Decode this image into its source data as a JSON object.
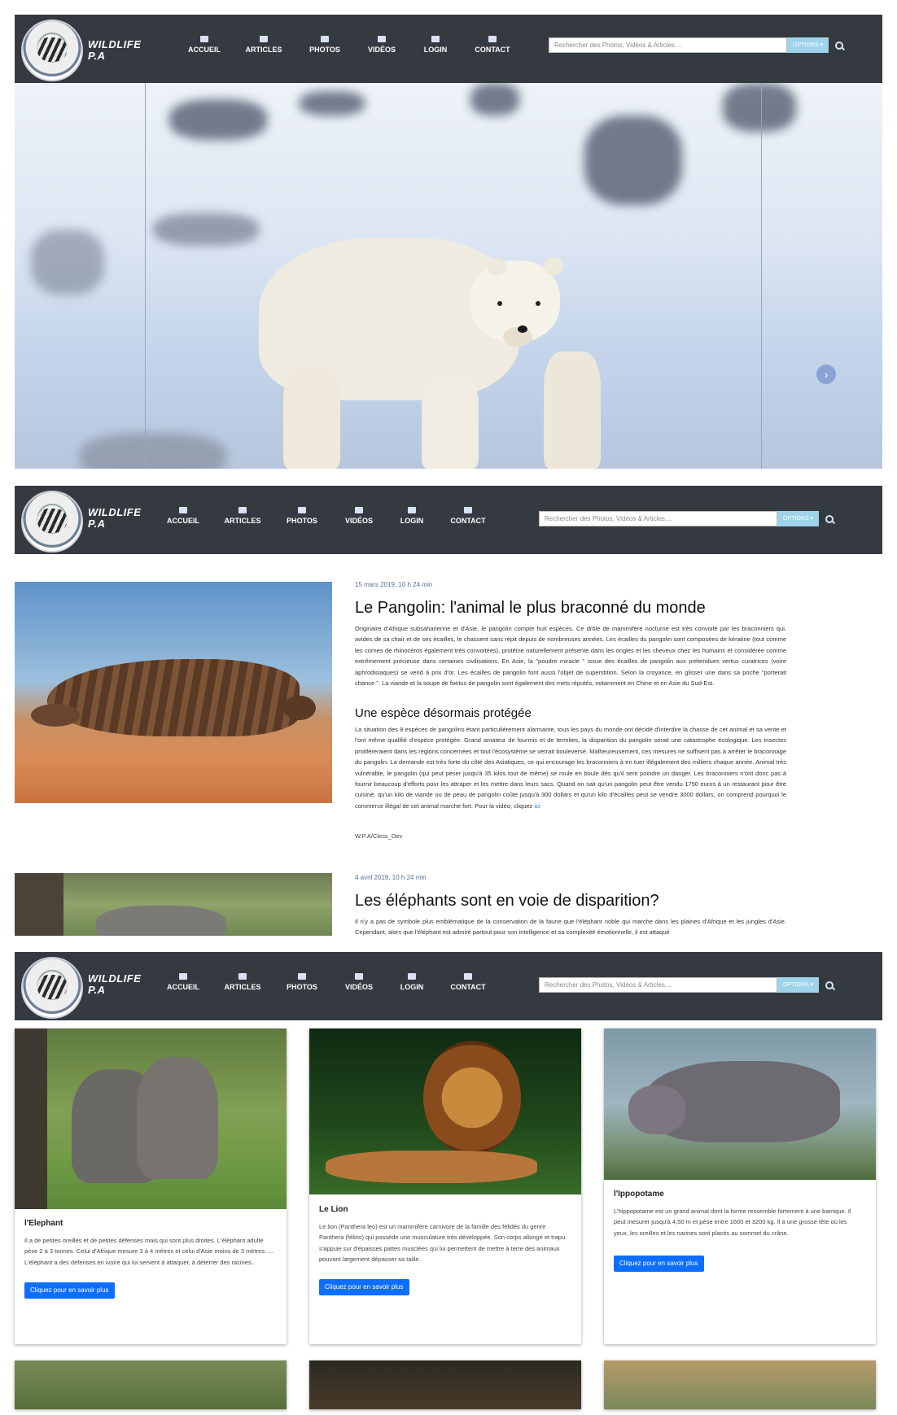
{
  "nav": {
    "brand": "WILDLIFE P.A",
    "brand_line1": "WILDLIFE",
    "brand_line2": "P.A",
    "items": [
      {
        "label": "ACCUEIL",
        "icon": "home-icon"
      },
      {
        "label": "ARTICLES",
        "icon": "article-icon"
      },
      {
        "label": "PHOTOS",
        "icon": "photo-icon"
      },
      {
        "label": "VIDÉOS",
        "icon": "video-icon"
      },
      {
        "label": "LOGIN",
        "icon": "user-icon"
      },
      {
        "label": "CONTACT",
        "icon": "contact-card-icon"
      }
    ],
    "search_placeholder": "Rechercher des Photos, Vidéos & Articles....",
    "options_label": "OPTIONS ▾"
  },
  "hero": {
    "next_arrow": "›"
  },
  "articles": [
    {
      "date": "15 mars 2019, 10 h 24 min",
      "title": "Le Pangolin: l'animal le plus braconné du monde",
      "body": "Originaire d'Afrique subsaharienne et d'Asie, le pangolin compte huit espèces. Ce drôle de mammifère nocturne est très convoité par les braconniers qui, avides de sa chair et de ses écailles, le chassent sans répit depuis de nombreuses années. Les écailles du pangolin sont composées de kératine (tout comme les cornes de rhinocéros également très convoitées), protéine naturellement présente dans les ongles et les cheveux chez les humains et considérée comme extrêmement précieuse dans certaines civilisations. En Asie, la \"poudre miracle \" issue des écailles de pangolin aux prétendues vertus curatrices (voire aphrodisiaques) se vend à prix d'or. Les écailles de pangolin font aussi l'objet de superstition. Selon la croyance, en glisser une dans sa poche \"porterait chance \". La viande et la soupe de foetus de pangolin sont également des mets réputés, notamment en Chine et en Asie du Sud-Est.",
      "subtitle": "Une espèce désormais protégée",
      "body2": "La situation des 8 espèces de pangolins étant particulièrement alarmante, tous les pays du monde ont décidé d'interdire la chasse de cet animal et sa vente et l'ont même qualifié d'espèce protégée. Grand amateur de fourmis et de termites, la disparition du pangolin serait une catastrophe écologique. Les insectes proliféreraient dans les régions concernées et tout l'écosystème se verrait bouleversé. Malheureusement, ces mesures ne suffisent pas à arrêter le braconnage du pangolin. La demande est très forte du côté des Asiatiques, ce qui encourage les braconniers à en tuer illégalement des milliers chaque année. Animal très vulnérable, le pangolin (qui peut peser jusqu'à 35 kilos tout de même) se roule en boule dès qu'il sent poindre un danger. Les braconniers n'ont donc pas à fournir beaucoup d'efforts pour les attraper et les mettre dans leurs sacs. Quand on sait qu'un pangolin peut être vendu 1750 euros à un restaurant pour être cuisiné, qu'un kilo de viande ou de peau de pangolin coûte jusqu'à 300 dollars et qu'un kilo d'écailles peut se vendre 3000 dollars, on comprend pourquoi le commerce illégal de cet animal marche fort. Pour la vidéo, cliquez",
      "link": "ici",
      "signature": "W.P.A/Cless_Dev"
    },
    {
      "date": "4 avril 2019, 10 h 24 min",
      "title": "Les éléphants sont en voie de disparition?",
      "body": "Il n'y a pas de symbole plus emblématique de la conservation de la faune que l'éléphant noble qui marche dans les plaines d'Afrique et les jungles d'Asie. Cependant, alors que l'éléphant est admiré partout pour son intelligence et sa complexité émotionnelle, il est attaqué"
    }
  ],
  "cards": [
    {
      "title": "l'Elephant",
      "text": "Il a de petites oreilles et de petites défenses mais qui sont plus droites. L'éléphant adulte pèse 2 à 3 tonnes. Celui d'Afrique mesure 3 à 4 mètres et celui d'Asie moins de 3 mètres. ... L'éléphant a des défenses en ivoire qui lui servent à attaquer, à déterrer des racines..",
      "button": "Cliquez pour en savoir plus"
    },
    {
      "title": "Le Lion",
      "text": "Le lion (Panthera leo) est un mammifère carnivore de la famille des félidés du genre Panthera (félins) qui possède une musculature très développée. Son corps allongé et trapu s'appuie sur d'épaisses pattes musclées qui lui permettent de mettre à terre des animaux pouvant largement dépasser sa taille.",
      "button": "Cliquez pour en savoir plus"
    },
    {
      "title": "l'Ippopotame",
      "text": "L'hippopotame est un grand animal dont la forme ressemble fortement à une barrique. Il peut mesurer jusqu'à 4,50 m et pèse entre 1600 et 3200 kg. Il a une grosse tête où les yeux, les oreilles et les narines sont placés au sommet du crâne.",
      "button": "Cliquez pour en savoir plus"
    }
  ]
}
